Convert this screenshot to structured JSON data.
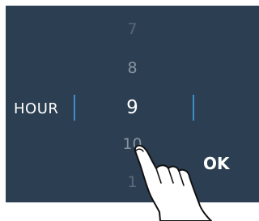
{
  "picker": {
    "label": "HOUR",
    "values": [
      "7",
      "8",
      "9",
      "10",
      "1"
    ],
    "selected": "9"
  },
  "actions": {
    "ok_label": "OK"
  },
  "colors": {
    "screen_bg": "#2c3e51",
    "selection_line": "#3f8ecb",
    "text_primary": "#ffffff",
    "text_dim": "#7c8a98"
  },
  "icons": {
    "hand": "pointing-hand-icon"
  }
}
